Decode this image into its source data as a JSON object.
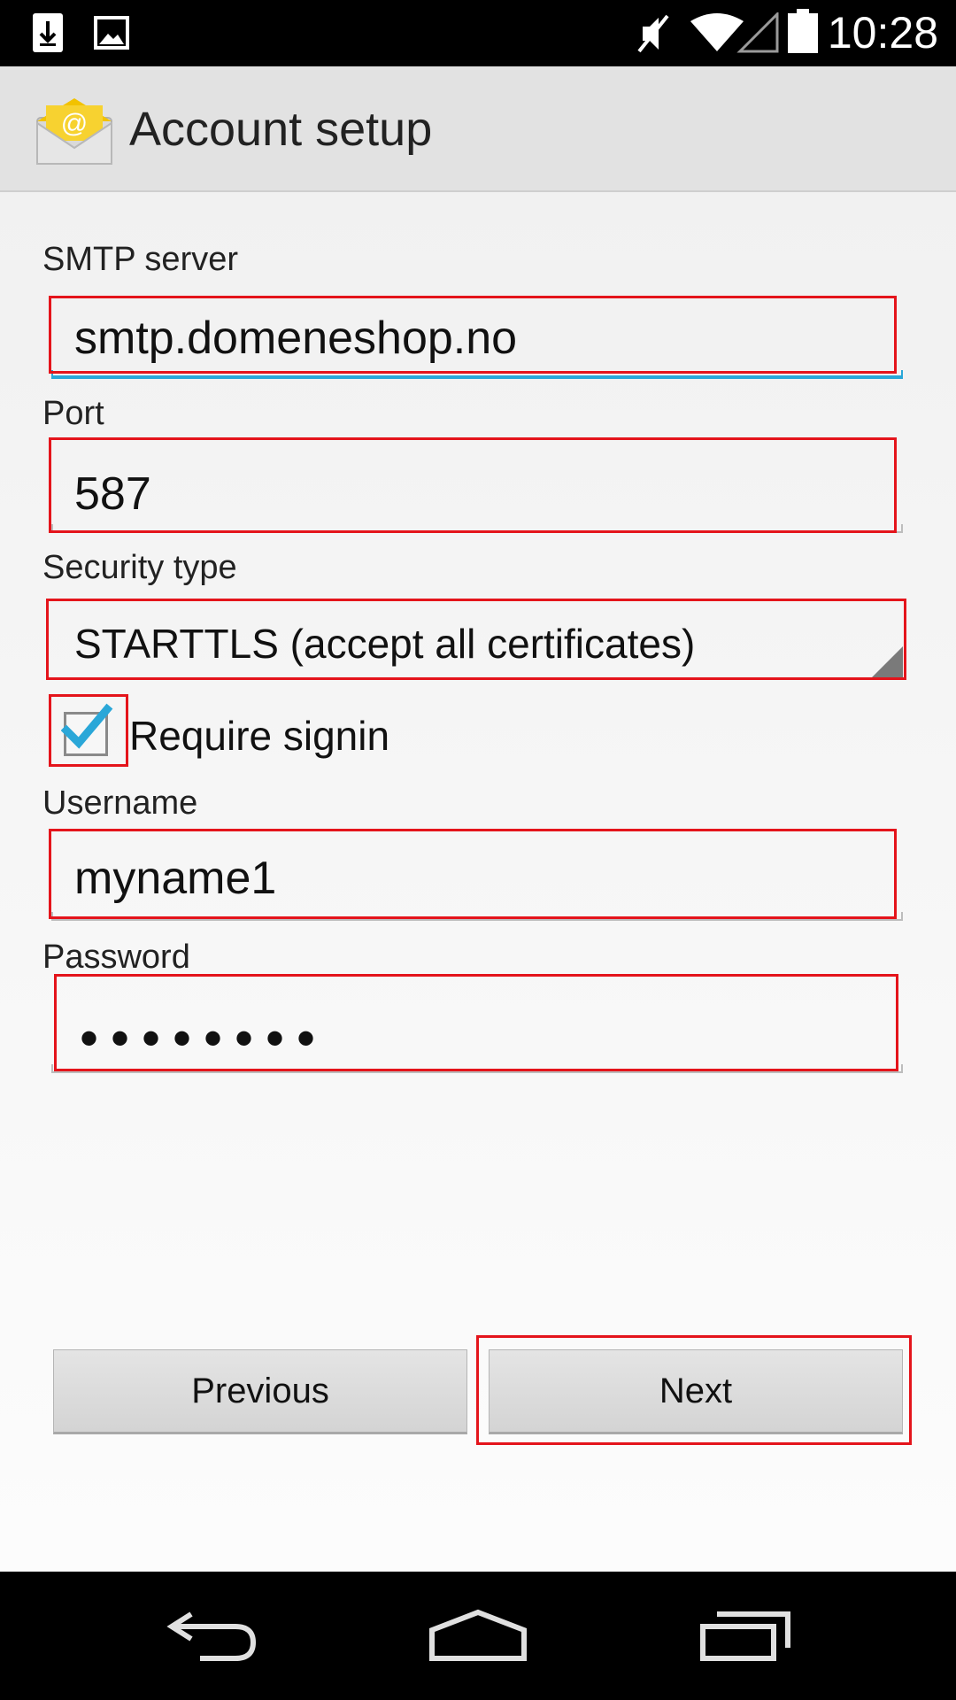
{
  "status_bar": {
    "time": "10:28",
    "icons": [
      "download-icon",
      "image-icon",
      "mute-icon",
      "wifi-icon",
      "signal-icon",
      "battery-icon"
    ]
  },
  "action_bar": {
    "title": "Account setup",
    "icon": "email-app-icon"
  },
  "form": {
    "smtp_label": "SMTP server",
    "smtp_value": "smtp.domeneshop.no",
    "port_label": "Port",
    "port_value": "587",
    "security_label": "Security type",
    "security_value": "STARTTLS (accept all certificates)",
    "require_signin_label": "Require signin",
    "require_signin_checked": true,
    "username_label": "Username",
    "username_value": "myname1",
    "password_label": "Password",
    "password_value": "••••••••"
  },
  "buttons": {
    "previous": "Previous",
    "next": "Next"
  },
  "colors": {
    "accent": "#2aa7d8",
    "highlight": "#e4141b"
  },
  "nav_bar": {
    "icons": [
      "back-icon",
      "home-icon",
      "recents-icon"
    ]
  }
}
